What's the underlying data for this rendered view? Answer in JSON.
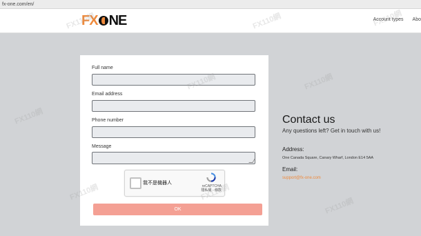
{
  "browser": {
    "url": "fx-one.com/en/"
  },
  "header": {
    "logo_fx": "FX",
    "logo_ne": "NE",
    "nav": [
      "Account types",
      "Abo"
    ]
  },
  "form": {
    "full_name_label": "Full name",
    "email_label": "Email address",
    "phone_label": "Phone number",
    "message_label": "Message",
    "captcha_text": "我不是機器人",
    "captcha_brand": "reCAPTCHA",
    "captcha_links": "隱私權 - 條款",
    "ok_label": "OK"
  },
  "contact": {
    "title": "Contact us",
    "subtitle": "Any questions left? Get in touch with us!",
    "address_label": "Address:",
    "address": "One Canada Square, Canary Wharf, London E14 5AA",
    "email_label": "Email:",
    "email": "support@fx-one.com"
  },
  "watermark": "FX110網",
  "colors": {
    "accent": "#ef8a3c",
    "button": "#f4a094",
    "background": "#d1d3d6"
  }
}
